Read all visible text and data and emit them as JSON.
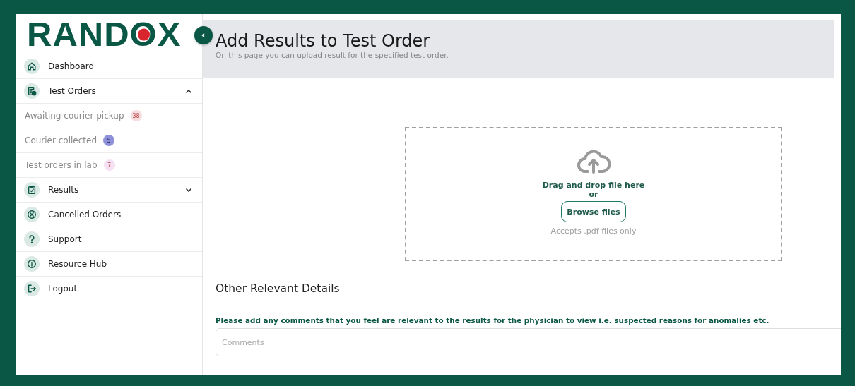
{
  "logo": "RANDOX",
  "sidebar": {
    "items": [
      {
        "kind": "nav",
        "label": "Dashboard"
      },
      {
        "kind": "group",
        "label": "Test Orders",
        "expanded": true,
        "children": [
          {
            "label": "Awaiting courier pickup",
            "count": "38",
            "color": "#f6dcdc"
          },
          {
            "label": "Courier collected",
            "count": "5",
            "color": "#8e90d8"
          },
          {
            "label": "Test orders in lab",
            "count": "7",
            "color": "#f6e0f4"
          }
        ]
      },
      {
        "kind": "group",
        "label": "Results",
        "expanded": false
      },
      {
        "kind": "nav",
        "label": "Cancelled Orders"
      },
      {
        "kind": "nav",
        "label": "Support"
      },
      {
        "kind": "nav",
        "label": "Resource Hub"
      },
      {
        "kind": "nav",
        "label": "Logout"
      }
    ]
  },
  "page_header": {
    "title": "Add Results to Test Order",
    "subtitle": "On this page you can upload result for the specified test order."
  },
  "upload": {
    "prompt": "Drag and drop file here",
    "or": "or",
    "button": "Browse files",
    "hint": "Accepts .pdf files only"
  },
  "details": {
    "heading": "Other Relevant Details",
    "instruction": "Please add any comments that you feel are relevant to the results for the physician to view i.e. suspected reasons for anomalies etc.",
    "placeholder": "Comments"
  }
}
